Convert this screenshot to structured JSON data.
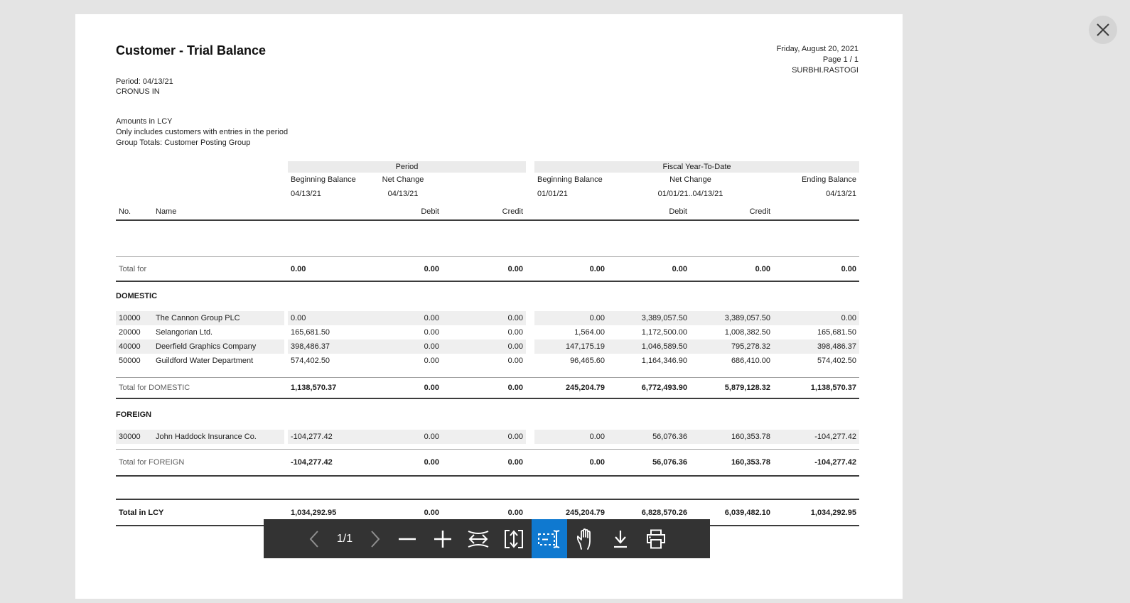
{
  "report": {
    "title": "Customer - Trial Balance",
    "period_line": "Period: 04/13/21",
    "company": "CRONUS IN",
    "meta": [
      "Amounts in LCY",
      "Only includes customers with entries in the period",
      "Group Totals: Customer Posting Group"
    ],
    "printed_date": "Friday, August 20, 2021",
    "page_label": "Page 1 / 1",
    "user": "SURBHI.RASTOGI"
  },
  "table": {
    "groups": {
      "period": "Period",
      "fytd": "Fiscal Year-To-Date"
    },
    "headers": {
      "beginning_balance": "Beginning Balance",
      "net_change": "Net Change",
      "ending_balance": "Ending Balance",
      "period_beg_date": "04/13/21",
      "period_net_date": "04/13/21",
      "fytd_beg_date": "01/01/21",
      "fytd_net_date": "01/01/21..04/13/21",
      "fytd_end_date": "04/13/21",
      "no": "No.",
      "name": "Name",
      "debit": "Debit",
      "credit": "Credit"
    },
    "total_for": {
      "label": "Total for",
      "values": [
        "0.00",
        "0.00",
        "0.00",
        "0.00",
        "0.00",
        "0.00",
        "0.00"
      ]
    },
    "sections": [
      {
        "name": "DOMESTIC",
        "rows": [
          {
            "no": "10000",
            "name": "The Cannon Group PLC",
            "values": [
              "0.00",
              "0.00",
              "0.00",
              "0.00",
              "3,389,057.50",
              "3,389,057.50",
              "0.00"
            ]
          },
          {
            "no": "20000",
            "name": "Selangorian Ltd.",
            "values": [
              "165,681.50",
              "0.00",
              "0.00",
              "1,564.00",
              "1,172,500.00",
              "1,008,382.50",
              "165,681.50"
            ]
          },
          {
            "no": "40000",
            "name": "Deerfield Graphics Company",
            "values": [
              "398,486.37",
              "0.00",
              "0.00",
              "147,175.19",
              "1,046,589.50",
              "795,278.32",
              "398,486.37"
            ]
          },
          {
            "no": "50000",
            "name": "Guildford Water Department",
            "values": [
              "574,402.50",
              "0.00",
              "0.00",
              "96,465.60",
              "1,164,346.90",
              "686,410.00",
              "574,402.50"
            ]
          }
        ],
        "total": {
          "label": "Total for DOMESTIC",
          "values": [
            "1,138,570.37",
            "0.00",
            "0.00",
            "245,204.79",
            "6,772,493.90",
            "5,879,128.32",
            "1,138,570.37"
          ]
        }
      },
      {
        "name": "FOREIGN",
        "rows": [
          {
            "no": "30000",
            "name": "John Haddock Insurance Co.",
            "values": [
              "-104,277.42",
              "0.00",
              "0.00",
              "0.00",
              "56,076.36",
              "160,353.78",
              "-104,277.42"
            ]
          }
        ],
        "total": {
          "label": "Total for FOREIGN",
          "values": [
            "-104,277.42",
            "0.00",
            "0.00",
            "0.00",
            "56,076.36",
            "160,353.78",
            "-104,277.42"
          ]
        }
      }
    ],
    "grand_total": {
      "label": "Total in LCY",
      "values": [
        "1,034,292.95",
        "0.00",
        "0.00",
        "245,204.79",
        "6,828,570.26",
        "6,039,482.10",
        "1,034,292.95"
      ]
    }
  },
  "toolbar": {
    "page_indicator": "1/1"
  },
  "colors": {
    "canvas_bg": "#e4e4e4",
    "page_bg": "#ffffff",
    "band_bg": "#ebebeb",
    "stripe_bg": "#efefef",
    "toolbar_bg": "#333333",
    "active_button": "#0f79d0"
  }
}
